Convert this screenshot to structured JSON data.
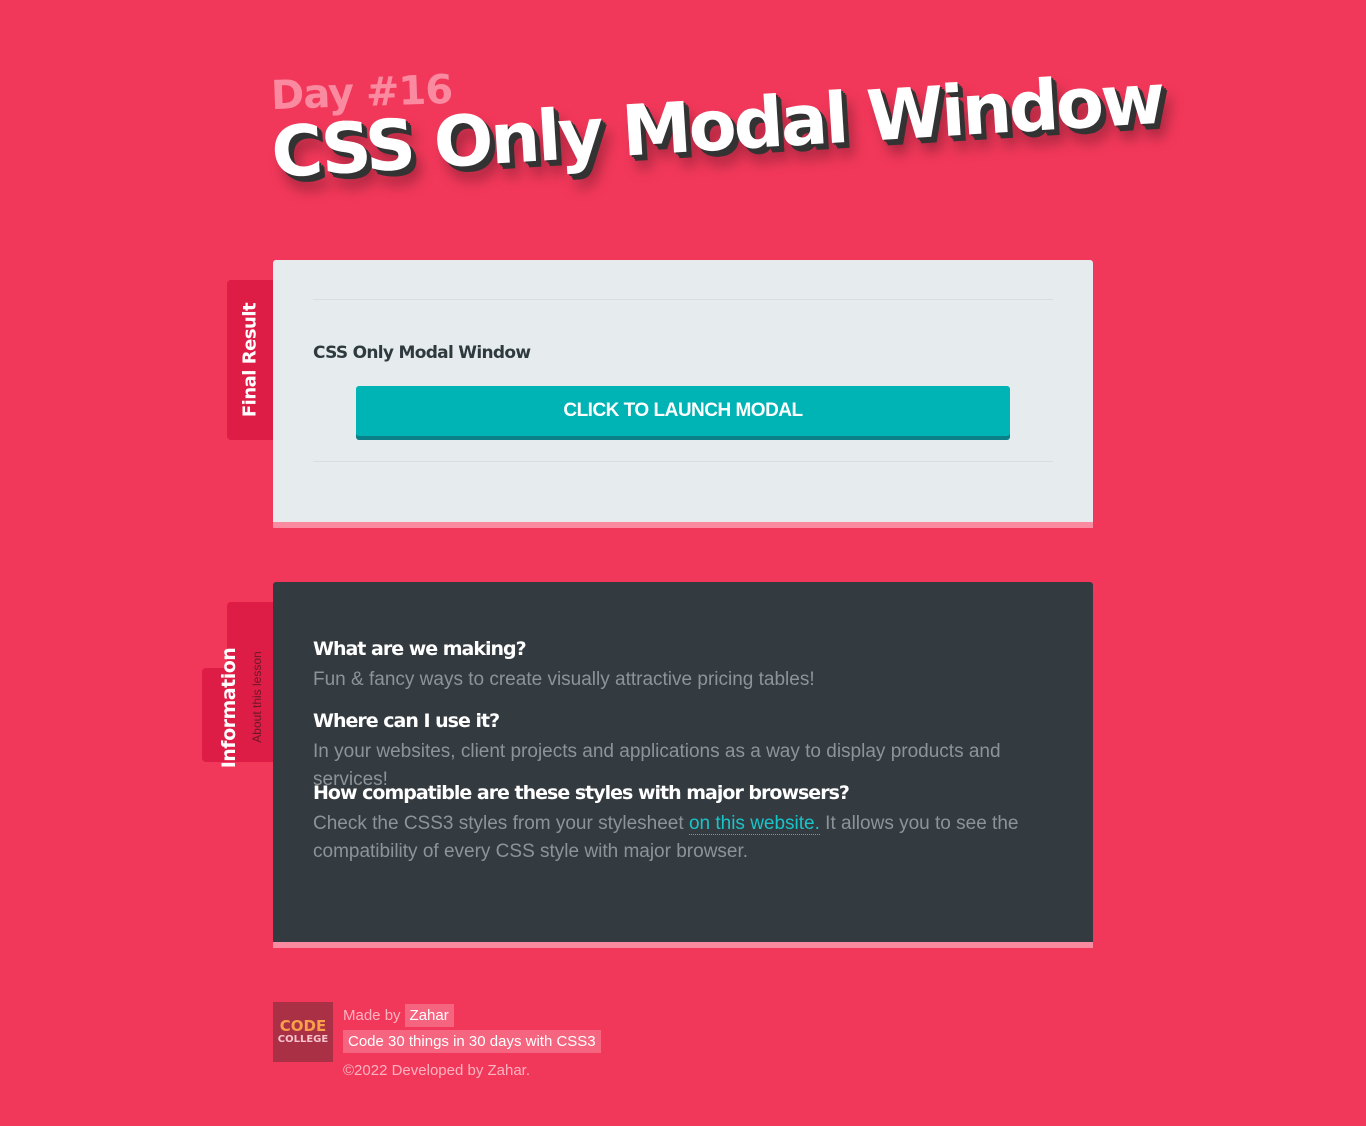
{
  "header": {
    "day": "Day #16",
    "title": "CSS Only Modal Window"
  },
  "tabs": {
    "final": "Final Result",
    "info_title": "Information",
    "info_sub": "About this lesson"
  },
  "result": {
    "demo_title": "CSS Only Modal Window",
    "launch_button": "CLICK TO LAUNCH MODAL"
  },
  "info": {
    "q1": "What are we making?",
    "a1": "Fun & fancy ways to create visually attractive pricing tables!",
    "q2": "Where can I use it?",
    "a2": "In your websites, client projects and applications as a way to display products and services!",
    "q3": "How compatible are these styles with major browsers?",
    "a3_before": "Check the CSS3 styles from your stylesheet ",
    "a3_link": "on this website.",
    "a3_after": " It allows you to see the compatibility of every CSS style with major browser."
  },
  "footer": {
    "logo_line1": "CODE",
    "logo_line2": "COLLEGE",
    "made_by": "Made by",
    "author": "Zahar",
    "course": "Code 30 things in 30 days with CSS3",
    "copyright": "©2022 Developed by Zahar."
  },
  "colors": {
    "background": "#f2385a",
    "accent": "#00b3b5",
    "panel_light": "#e6ecee",
    "panel_dark": "#343b40"
  }
}
